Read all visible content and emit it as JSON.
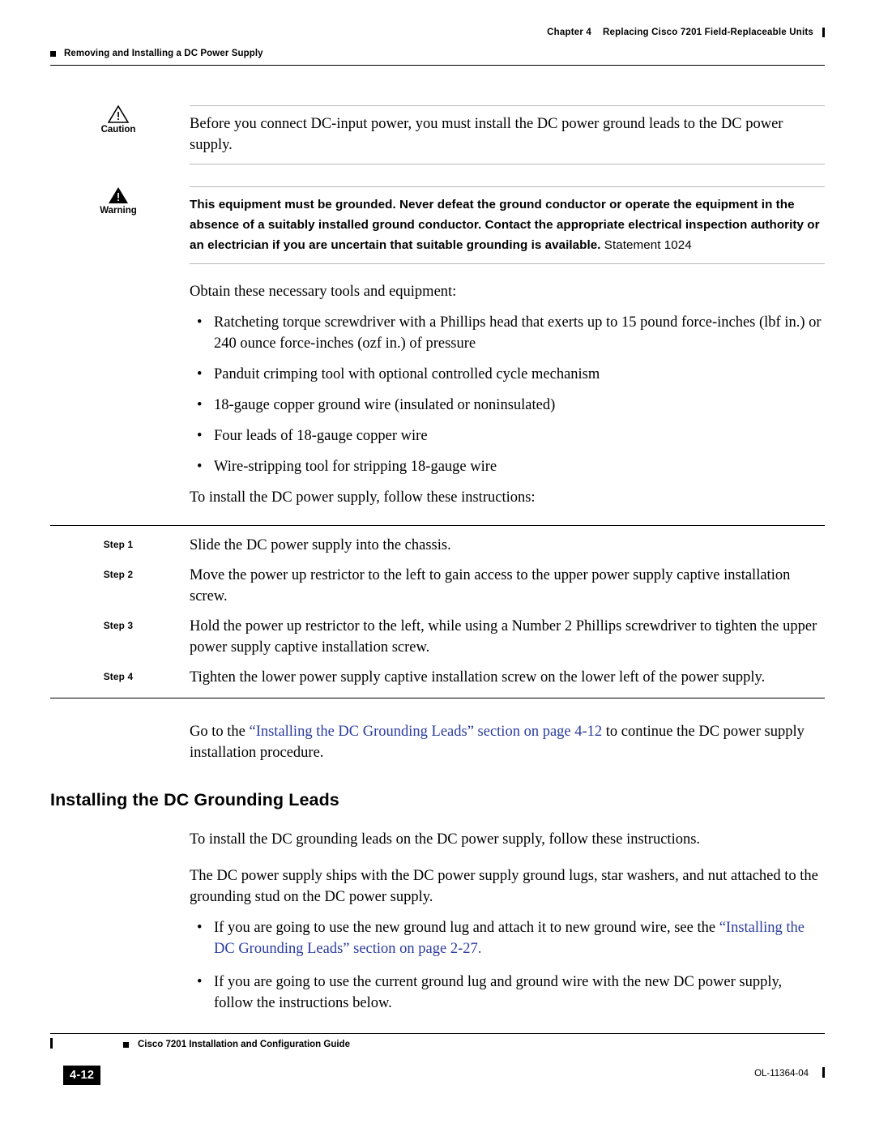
{
  "header": {
    "chapter": "Chapter 4",
    "chapter_title": "Replacing Cisco 7201 Field-Replaceable Units",
    "running_head": "Removing and Installing a DC Power Supply"
  },
  "caution": {
    "label": "Caution",
    "text": "Before you connect DC-input power, you must install the DC power ground leads to the DC power supply."
  },
  "warning": {
    "label": "Warning",
    "text": "This equipment must be grounded. Never defeat the ground conductor or operate the equipment in the absence of a suitably installed ground conductor. Contact the appropriate electrical inspection authority or an electrician if you are uncertain that suitable grounding is available.",
    "statement": "Statement 1024"
  },
  "tools": {
    "intro": "Obtain these necessary tools and equipment:",
    "items": [
      "Ratcheting torque screwdriver with a Phillips head that exerts up to 15 pound force-inches (lbf in.) or 240 ounce force-inches (ozf in.) of pressure",
      "Panduit crimping tool with optional controlled cycle mechanism",
      "18-gauge copper ground wire (insulated or noninsulated)",
      "Four leads of 18-gauge copper wire",
      "Wire-stripping tool for stripping 18-gauge wire"
    ],
    "outro": "To install the DC power supply, follow these instructions:"
  },
  "steps": [
    {
      "label": "Step 1",
      "text": "Slide the DC power supply into the chassis."
    },
    {
      "label": "Step 2",
      "text": "Move the power up restrictor to the left to gain access to the upper power supply captive installation screw."
    },
    {
      "label": "Step 3",
      "text": "Hold the power up restrictor to the left, while using a Number 2 Phillips screwdriver to tighten the upper power supply captive installation screw."
    },
    {
      "label": "Step 4",
      "text": "Tighten the lower power supply captive installation screw on the lower left of the power supply."
    }
  ],
  "goto": {
    "prefix": "Go to the ",
    "link": "“Installing the DC Grounding Leads” section on page 4-12",
    "suffix": " to continue the DC power supply installation procedure."
  },
  "section": {
    "heading": "Installing the DC Grounding Leads",
    "para1": "To install the DC grounding leads on the DC power supply, follow these instructions.",
    "para2": "The DC power supply ships with the DC power supply ground lugs, star washers, and nut attached to the grounding stud on the DC power supply.",
    "bullet1_prefix": "If you are going to use the new ground lug and attach it to new ground wire, see the ",
    "bullet1_link": "“Installing the DC Grounding Leads” section on page 2-27",
    "bullet1_suffix": ".",
    "bullet2": "If you are going to use the current ground lug and ground wire with the new DC power supply, follow the instructions below."
  },
  "footer": {
    "guide": "Cisco 7201 Installation and Configuration Guide",
    "page": "4-12",
    "doc_number": "OL-11364-04"
  },
  "colors": {
    "link": "#2b3c9e",
    "rule": "#000000",
    "rule_light": "#b9b9b9"
  },
  "icons": {
    "caution": "caution-triangle-icon",
    "warning": "warning-triangle-icon",
    "bullet": "bullet-dot"
  }
}
